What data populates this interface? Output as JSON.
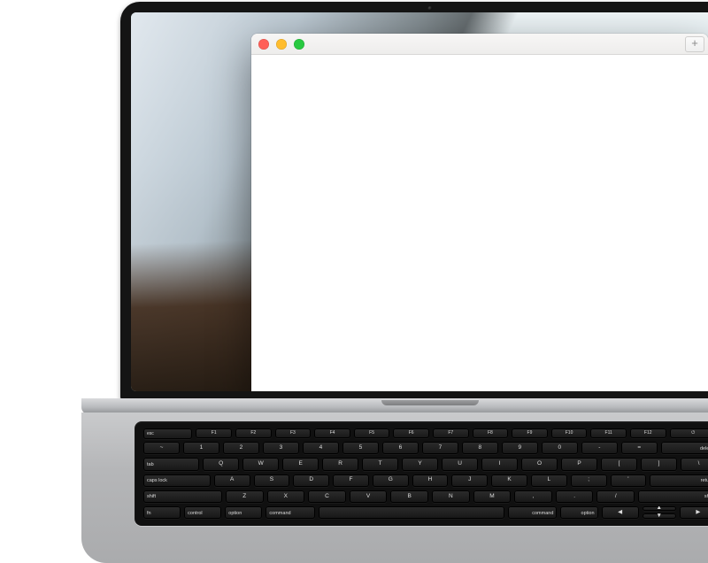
{
  "window": {
    "traffic_lights": {
      "close": "close",
      "minimize": "minimize",
      "maximize": "maximize"
    },
    "new_tab_label": "+"
  },
  "keyboard": {
    "fn_row": [
      "esc",
      "F1",
      "F2",
      "F3",
      "F4",
      "F5",
      "F6",
      "F7",
      "F8",
      "F9",
      "F10",
      "F11",
      "F12",
      "⏻"
    ],
    "row1": [
      "~",
      "1",
      "2",
      "3",
      "4",
      "5",
      "6",
      "7",
      "8",
      "9",
      "0",
      "-",
      "=",
      "delete"
    ],
    "row2": [
      "tab",
      "Q",
      "W",
      "E",
      "R",
      "T",
      "Y",
      "U",
      "I",
      "O",
      "P",
      "[",
      "]",
      "\\"
    ],
    "row3": [
      "caps lock",
      "A",
      "S",
      "D",
      "F",
      "G",
      "H",
      "J",
      "K",
      "L",
      ";",
      "'",
      "return"
    ],
    "row4": [
      "shift",
      "Z",
      "X",
      "C",
      "V",
      "B",
      "N",
      "M",
      ",",
      ".",
      "/",
      "shift"
    ],
    "row5": [
      "fn",
      "control",
      "option",
      "command",
      "",
      "command",
      "option"
    ],
    "arrows": {
      "left": "◀",
      "up": "▲",
      "down": "▼",
      "right": "▶"
    }
  }
}
